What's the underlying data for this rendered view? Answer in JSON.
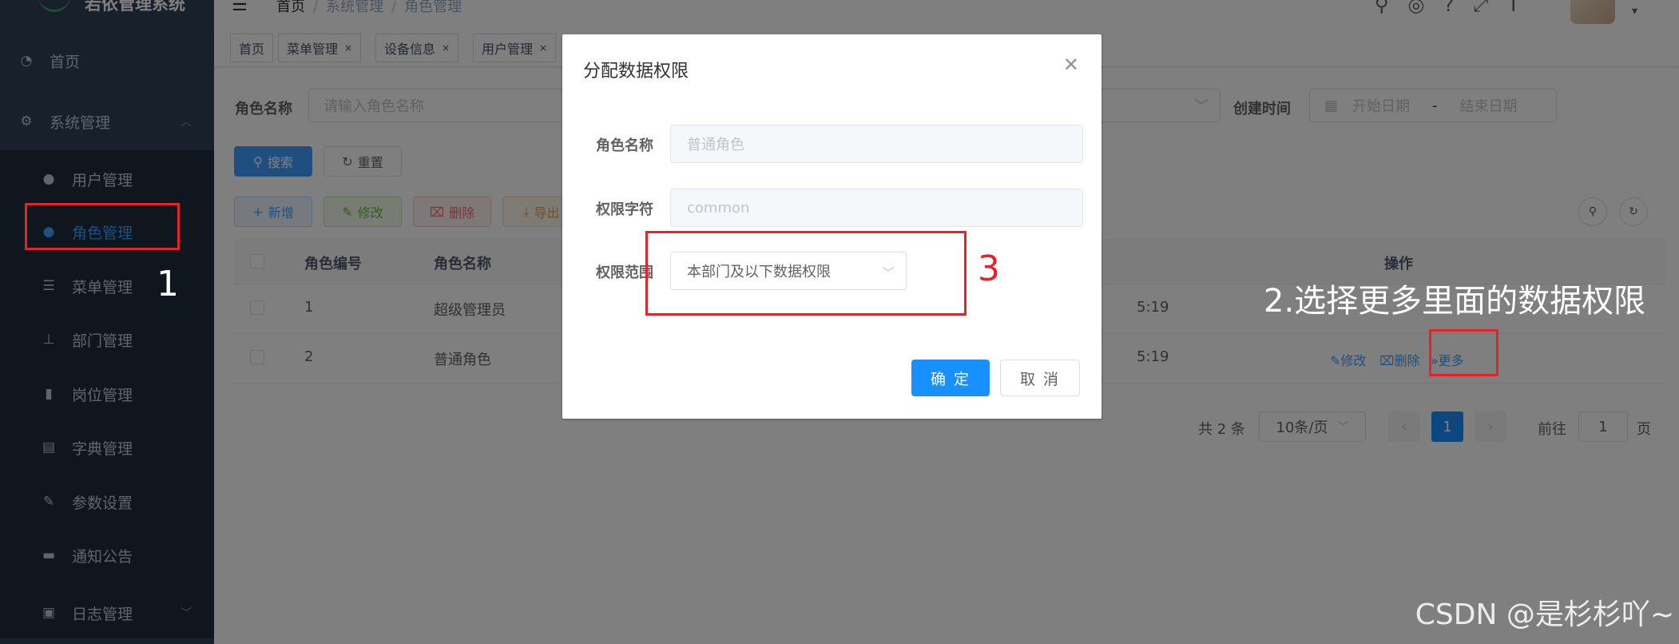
{
  "app": {
    "title": "若依管理系统"
  },
  "sidebar": {
    "items": [
      {
        "label": "首页",
        "icon": "dashboard-icon"
      },
      {
        "label": "系统管理",
        "icon": "gear-icon"
      },
      {
        "label": "用户管理",
        "icon": "user-icon"
      },
      {
        "label": "角色管理",
        "icon": "users-icon"
      },
      {
        "label": "菜单管理",
        "icon": "tree-table-icon"
      },
      {
        "label": "部门管理",
        "icon": "org-tree-icon"
      },
      {
        "label": "岗位管理",
        "icon": "post-icon"
      },
      {
        "label": "字典管理",
        "icon": "dict-icon"
      },
      {
        "label": "参数设置",
        "icon": "edit-icon"
      },
      {
        "label": "通知公告",
        "icon": "message-icon"
      },
      {
        "label": "日志管理",
        "icon": "log-icon"
      }
    ]
  },
  "breadcrumb": [
    "首页",
    "系统管理",
    "角色管理"
  ],
  "tags": [
    {
      "label": "首页"
    },
    {
      "label": "菜单管理"
    },
    {
      "label": "设备信息"
    },
    {
      "label": "用户管理"
    }
  ],
  "search": {
    "role_name_label": "角色名称",
    "role_name_placeholder": "请输入角色名称",
    "create_time_label": "创建时间",
    "start_placeholder": "开始日期",
    "range_sep": "-",
    "end_placeholder": "结束日期",
    "search_btn": "搜索",
    "reset_btn": "重置"
  },
  "toolbar": {
    "add": "新增",
    "edit": "修改",
    "delete": "删除",
    "export": "导出"
  },
  "table": {
    "headers": {
      "id": "角色编号",
      "name": "角色名称",
      "ops": "操作"
    },
    "rows": [
      {
        "id": "1",
        "name": "超级管理员",
        "time": "5:19"
      },
      {
        "id": "2",
        "name": "普通角色",
        "time": "5:19",
        "edit": "修改",
        "delete": "删除",
        "more": "更多"
      }
    ]
  },
  "pagination": {
    "total": "共 2 条",
    "page_size": "10条/页",
    "current": "1",
    "goto_prefix": "前往",
    "goto_value": "1",
    "goto_suffix": "页"
  },
  "dialog": {
    "title": "分配数据权限",
    "role_name_label": "角色名称",
    "role_name_value": "普通角色",
    "perm_key_label": "权限字符",
    "perm_key_value": "common",
    "scope_label": "权限范围",
    "scope_value": "本部门及以下数据权限",
    "ok": "确 定",
    "cancel": "取 消"
  },
  "annotations": {
    "step1": "1",
    "step2": "2.选择更多里面的数据权限",
    "step3": "3"
  },
  "watermark": "CSDN @是杉杉吖~",
  "colors": {
    "sidebar": "#304156",
    "primary": "#409eff",
    "annotation": "#e5232a"
  }
}
